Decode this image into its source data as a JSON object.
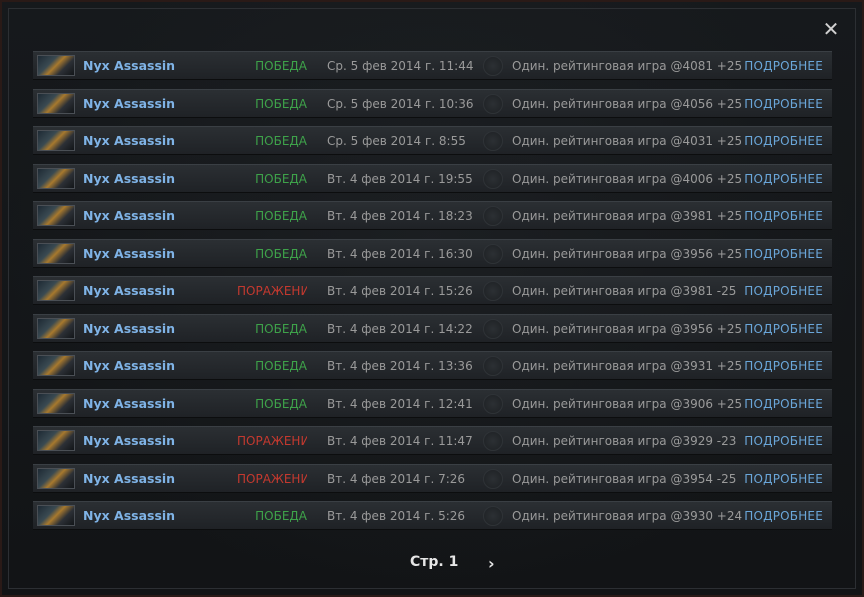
{
  "close_icon": "close-icon",
  "matches": [
    {
      "hero": "Nyx Assassin",
      "result": "ПОБЕДА",
      "outcome": "win",
      "date": "Ср. 5 фев 2014 г. 11:44",
      "mode": "Один. рейтинговая игра @4081 +25",
      "details": "ПОДРОБНЕЕ"
    },
    {
      "hero": "Nyx Assassin",
      "result": "ПОБЕДА",
      "outcome": "win",
      "date": "Ср. 5 фев 2014 г. 10:36",
      "mode": "Один. рейтинговая игра @4056 +25",
      "details": "ПОДРОБНЕЕ"
    },
    {
      "hero": "Nyx Assassin",
      "result": "ПОБЕДА",
      "outcome": "win",
      "date": "Ср. 5 фев 2014 г. 8:55",
      "mode": "Один. рейтинговая игра @4031 +25",
      "details": "ПОДРОБНЕЕ"
    },
    {
      "hero": "Nyx Assassin",
      "result": "ПОБЕДА",
      "outcome": "win",
      "date": "Вт. 4 фев 2014 г. 19:55",
      "mode": "Один. рейтинговая игра @4006 +25",
      "details": "ПОДРОБНЕЕ"
    },
    {
      "hero": "Nyx Assassin",
      "result": "ПОБЕДА",
      "outcome": "win",
      "date": "Вт. 4 фев 2014 г. 18:23",
      "mode": "Один. рейтинговая игра @3981 +25",
      "details": "ПОДРОБНЕЕ"
    },
    {
      "hero": "Nyx Assassin",
      "result": "ПОБЕДА",
      "outcome": "win",
      "date": "Вт. 4 фев 2014 г. 16:30",
      "mode": "Один. рейтинговая игра @3956 +25",
      "details": "ПОДРОБНЕЕ"
    },
    {
      "hero": "Nyx Assassin",
      "result": "ПОРАЖЕНИ",
      "outcome": "loss",
      "date": "Вт. 4 фев 2014 г. 15:26",
      "mode": "Один. рейтинговая игра @3981 -25",
      "details": "ПОДРОБНЕЕ"
    },
    {
      "hero": "Nyx Assassin",
      "result": "ПОБЕДА",
      "outcome": "win",
      "date": "Вт. 4 фев 2014 г. 14:22",
      "mode": "Один. рейтинговая игра @3956 +25",
      "details": "ПОДРОБНЕЕ"
    },
    {
      "hero": "Nyx Assassin",
      "result": "ПОБЕДА",
      "outcome": "win",
      "date": "Вт. 4 фев 2014 г. 13:36",
      "mode": "Один. рейтинговая игра @3931 +25",
      "details": "ПОДРОБНЕЕ"
    },
    {
      "hero": "Nyx Assassin",
      "result": "ПОБЕДА",
      "outcome": "win",
      "date": "Вт. 4 фев 2014 г. 12:41",
      "mode": "Один. рейтинговая игра @3906 +25",
      "details": "ПОДРОБНЕЕ"
    },
    {
      "hero": "Nyx Assassin",
      "result": "ПОРАЖЕНИ",
      "outcome": "loss",
      "date": "Вт. 4 фев 2014 г. 11:47",
      "mode": "Один. рейтинговая игра @3929 -23",
      "details": "ПОДРОБНЕЕ"
    },
    {
      "hero": "Nyx Assassin",
      "result": "ПОРАЖЕНИ",
      "outcome": "loss",
      "date": "Вт. 4 фев 2014 г. 7:26",
      "mode": "Один. рейтинговая игра @3954 -25",
      "details": "ПОДРОБНЕЕ"
    },
    {
      "hero": "Nyx Assassin",
      "result": "ПОБЕДА",
      "outcome": "win",
      "date": "Вт. 4 фев 2014 г. 5:26",
      "mode": "Один. рейтинговая игра @3930 +24",
      "details": "ПОДРОБНЕЕ"
    }
  ],
  "pager": {
    "label": "Стр. 1",
    "next_icon": "chevron-right-icon"
  },
  "colors": {
    "win": "#3ea24a",
    "loss": "#c4392f",
    "hero": "#7fb3e6",
    "link": "#6aa6d9"
  }
}
